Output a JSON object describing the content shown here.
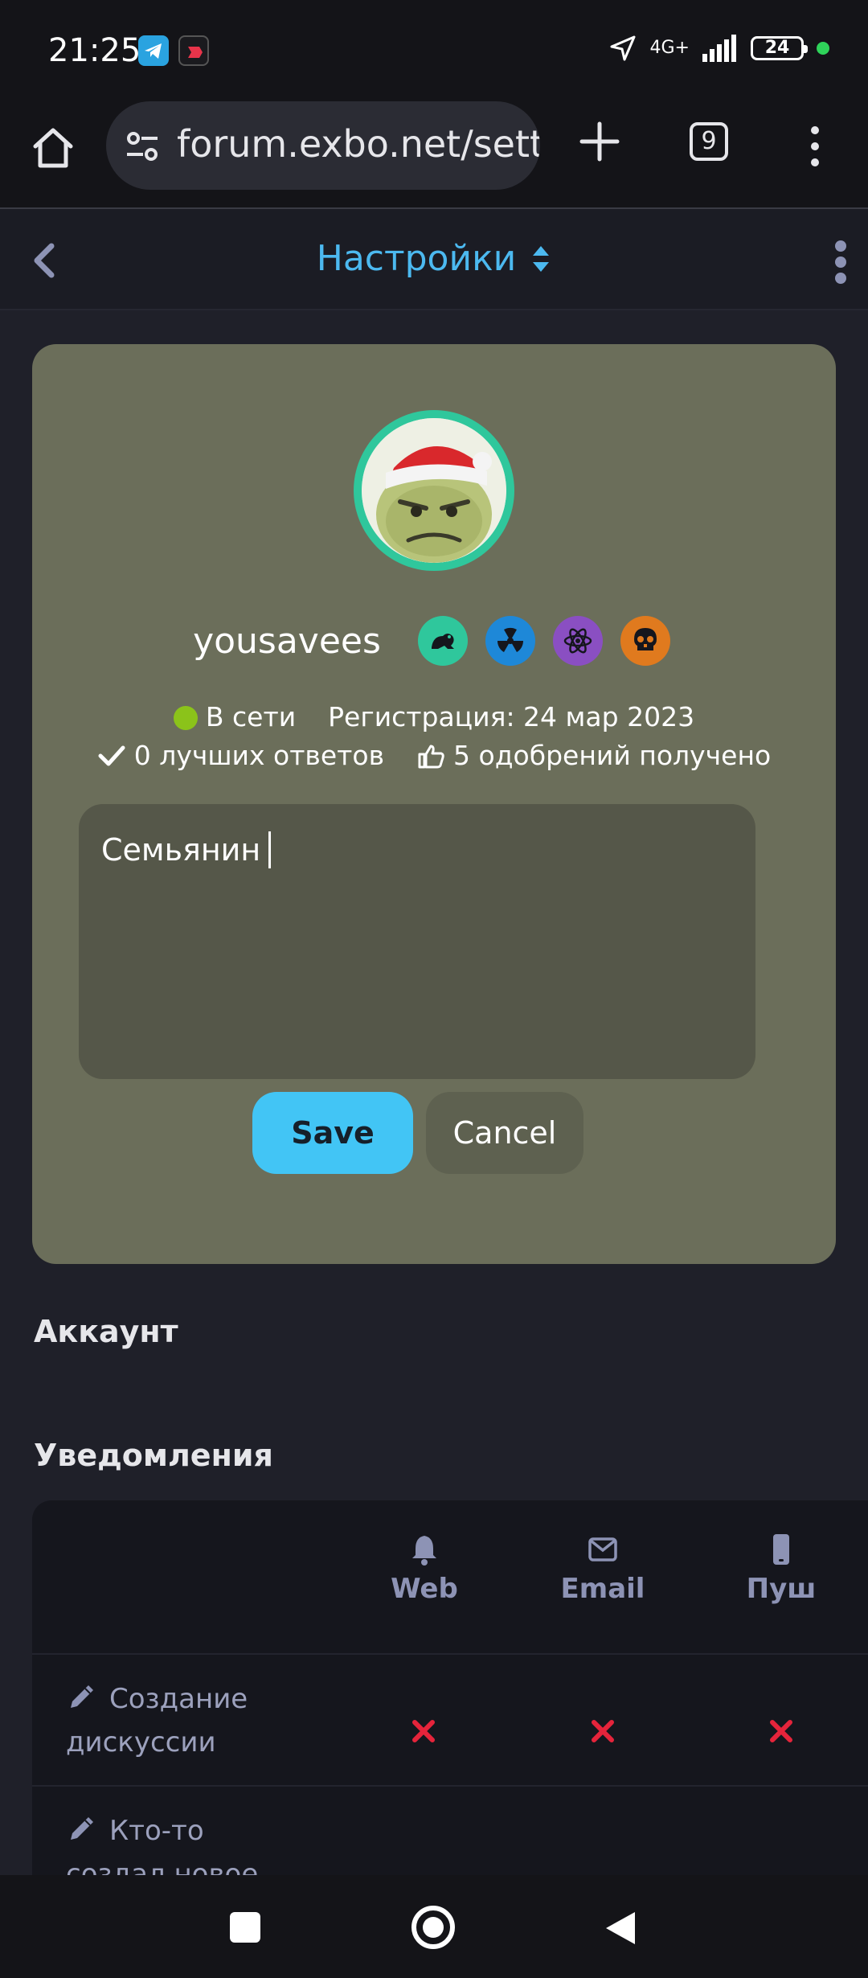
{
  "status_bar": {
    "time": "21:25",
    "network": "4G+",
    "battery": "24"
  },
  "browser": {
    "url": "forum.exbo.net/settings",
    "tab_count": "9"
  },
  "forum_header": {
    "title": "Настройки"
  },
  "profile": {
    "username": "yousavees",
    "status": "В сети",
    "registration": "Регистрация: 24 мар 2023",
    "best_answers": "0 лучших ответов",
    "likes": "5 одобрений получено",
    "bio": "Семьянин",
    "badges": [
      "frog-icon",
      "radiation-icon",
      "atom-icon",
      "skull-icon"
    ],
    "colors": {
      "card": "#6b6e5a",
      "avatar_ring": "#2fc79c",
      "online": "#8bc31a"
    }
  },
  "buttons": {
    "save": "Save",
    "cancel": "Cancel"
  },
  "sections": {
    "account": "Аккаунт",
    "notifications": "Уведомления"
  },
  "notifications_table": {
    "columns": [
      "Web",
      "Email",
      "Пуш"
    ],
    "rows": [
      {
        "label": "Создание дискуссии",
        "web": false,
        "email": false,
        "push": false
      },
      {
        "label": "Кто-то создал новое"
      }
    ]
  }
}
